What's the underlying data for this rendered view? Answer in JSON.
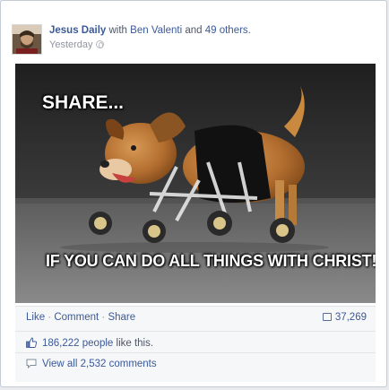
{
  "post": {
    "author": "Jesus Daily",
    "with_text": "with",
    "tagged_person": "Ben Valenti",
    "and_text": "and",
    "others": "49 others",
    "period": ".",
    "time": "Yesterday",
    "privacy_icon": "globe-icon"
  },
  "photo": {
    "caption_top": "SHARE...",
    "caption_bottom": "IF YOU CAN DO ALL THINGS WITH CHRIST!"
  },
  "actions": {
    "like": "Like",
    "dot1": " · ",
    "comment": "Comment",
    "dot2": " · ",
    "share": "Share",
    "share_count": "37,269",
    "share_icon": "share-count-icon"
  },
  "likes": {
    "count": "186,222 people",
    "suffix": " like this.",
    "icon": "thumbs-up-icon"
  },
  "comments": {
    "label": "View all 2,532 comments",
    "icon": "comment-bubble-icon"
  },
  "colors": {
    "link": "#3b5998",
    "footer_bg": "#f6f7f9",
    "muted": "#90949c"
  }
}
